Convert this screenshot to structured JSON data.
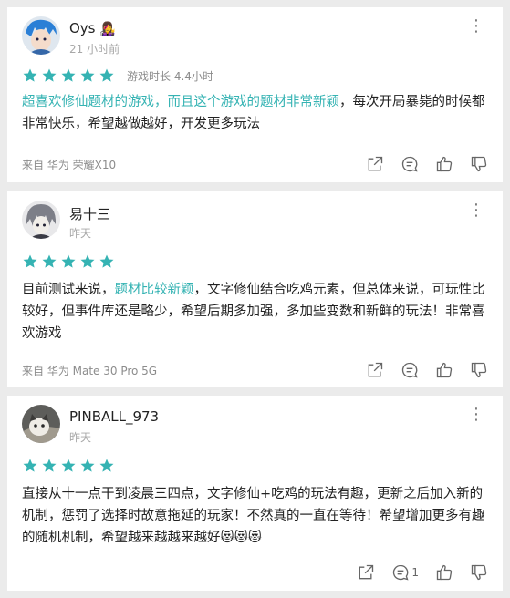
{
  "colors": {
    "accent": "#35b3b3",
    "star": "#35b3b3",
    "background": "#ebebeb"
  },
  "reviews": [
    {
      "username": "Oys",
      "time": "21 小时前",
      "rating": 5,
      "meta": "游戏时长 4.4小时",
      "text_segments": [
        {
          "text": "超喜欢修仙题材的游戏，而且这个游戏的题材非常新颖",
          "highlight": true
        },
        {
          "text": "，每次开局暴毙的时候都非常快乐，希望越做越好，开发更多玩法",
          "highlight": false
        }
      ],
      "device": "来自 华为 荣耀X10",
      "actions": [
        "share-icon",
        "comment-icon",
        "like-icon",
        "dislike-icon"
      ],
      "comment_count": ""
    },
    {
      "username": "易十三",
      "time": "昨天",
      "rating": 5,
      "meta": "",
      "text_segments": [
        {
          "text": "目前测试来说，",
          "highlight": false
        },
        {
          "text": "题材比较新颖",
          "highlight": true
        },
        {
          "text": "，文字修仙结合吃鸡元素，但总体来说，可玩性比较好，但事件库还是略少，希望后期多加强，多加些变数和新鲜的玩法！非常喜欢游戏",
          "highlight": false
        }
      ],
      "device": "来自 华为 Mate 30 Pro 5G",
      "actions": [
        "share-icon",
        "comment-icon",
        "like-icon",
        "dislike-icon"
      ],
      "comment_count": ""
    },
    {
      "username": "PINBALL_973",
      "time": "昨天",
      "rating": 5,
      "meta": "",
      "text_segments": [
        {
          "text": "直接从十一点干到凌晨三四点，文字修仙+吃鸡的玩法有趣，更新之后加入新的机制，惩罚了选择时故意拖延的玩家！不然真的一直在等待！希望增加更多有趣的随机机制，希望越来越越来越好😻😻😻",
          "highlight": false
        }
      ],
      "device": "",
      "actions": [
        "share-icon",
        "comment-icon",
        "like-icon",
        "dislike-icon"
      ],
      "comment_count": "1"
    }
  ]
}
